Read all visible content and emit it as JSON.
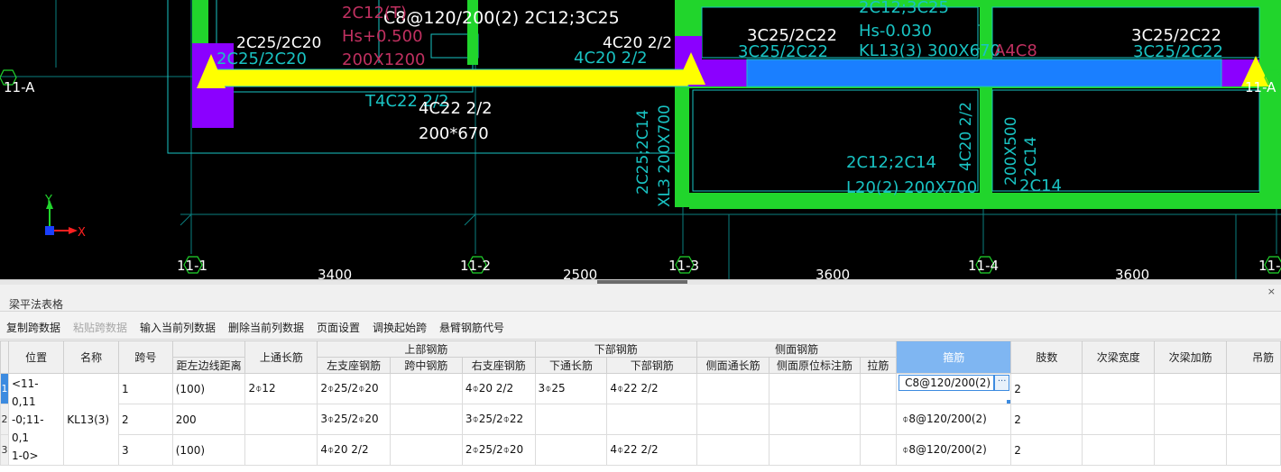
{
  "cad": {
    "labels": {
      "top_left_partial": "C8@120/200(2) 2C12;3C25",
      "cyan_2c12t": "2C12(T)",
      "cyan_hs0500": "Hs+0.500",
      "cyan_200x1200": "200X1200",
      "white_2c25_2c20": "2C25/2C20",
      "cyan_2c25_2c20": "2C25/2C20",
      "white_4c20_22": "4C20 2/2",
      "cyan_4c20_22": "4C20 2/2",
      "white_3c25_2c22_a": "3C25/2C22",
      "cyan_3c25_2c22_a": "3C25/2C22",
      "white_3c25_2c22_b": "3C25/2C22",
      "cyan_3c25_2c22_b": "3C25/2C22",
      "cyan_2c12_3c25": "2C12;3C25",
      "cyan_hs0030": "Hs-0.030",
      "cyan_kl13": "KL13(3) 300X670",
      "cyan_a4c8": "A4C8",
      "cyan_t4c22": "T4C22 2/2",
      "white_4c22": "4C22 2/2",
      "white_200x670": "200*670",
      "cyan_2c25_2c14": "2C25;2C14",
      "cyan_xl3": "XL3 200X700",
      "cyan_2c12_2c14": "2C12;2C14",
      "cyan_l20": "L20(2) 200X700",
      "cyan_4c20_22_v": "4C20 2/2",
      "cyan_200x500": "200X500",
      "cyan_2c14_a": "2C14",
      "cyan_2c14_b": "2C14",
      "axis_11a": "11-A",
      "axis_11a_right": "11-A",
      "axis_11_1": "11-1",
      "axis_11_2": "11-2",
      "axis_11_3": "11-3",
      "axis_11_4": "11-4",
      "axis_11_5": "11-",
      "dim_3400": "3400",
      "dim_2500": "2500",
      "dim_3600_a": "3600",
      "dim_3600_b": "3600",
      "ucs_y": "Y",
      "ucs_x": "X"
    },
    "colors": {
      "background": "#000000",
      "column_green": "#21d52c",
      "support_purple": "#8b00ff",
      "selected_beam_yellow": "#ffff00",
      "beam_blue": "#1a7fff",
      "cyan_text": "#19c3c3",
      "axis_line": "#008f8f"
    }
  },
  "panel": {
    "title": "梁平法表格",
    "close_label": "×",
    "toolbar": [
      {
        "label": "复制跨数据",
        "enabled": true
      },
      {
        "label": "粘贴跨数据",
        "enabled": false
      },
      {
        "label": "输入当前列数据",
        "enabled": true
      },
      {
        "label": "删除当前列数据",
        "enabled": true
      },
      {
        "label": "页面设置",
        "enabled": true
      },
      {
        "label": "调换起始跨",
        "enabled": true
      },
      {
        "label": "悬臂钢筋代号",
        "enabled": true
      }
    ]
  },
  "grid": {
    "headers": {
      "position": "位置",
      "name": "名称",
      "span_no": "跨号",
      "dist_left_edge": "距左边线距离",
      "top_through": "上通长筋",
      "top_group": "上部钢筋",
      "top_left_support": "左支座钢筋",
      "top_mid_span": "跨中钢筋",
      "top_right_support": "右支座钢筋",
      "bottom_group": "下部钢筋",
      "bottom_through": "下通长筋",
      "bottom_rebar": "下部钢筋",
      "side_group": "侧面钢筋",
      "side_through": "侧面通长筋",
      "side_in_situ": "侧面原位标注筋",
      "tie_bar": "拉筋",
      "stirrup": "箍筋",
      "legs": "肢数",
      "sec_beam_width": "次梁宽度",
      "sec_beam_rebar": "次梁加筋",
      "hanger": "吊筋"
    },
    "position_value": "<11-0,11-0;11-0,11-0>",
    "position_lines": [
      "<11-0,11",
      "-0;11-0,1",
      "1-0>"
    ],
    "name_value": "KL13(3)",
    "ellipsis": "···",
    "rows": [
      {
        "row_no": "1",
        "span_no": "1",
        "dist_left_edge": "(100)",
        "top_through": "2⌽12",
        "top_left_support": "2⌽25/2⌽20",
        "top_mid_span": "",
        "top_right_support": "4⌽20 2/2",
        "bottom_through": "3⌽25",
        "bottom_rebar": "4⌽22 2/2",
        "side_through": "",
        "side_in_situ": "",
        "tie_bar": "",
        "stirrup": "C8@120/200(2)",
        "legs": "2",
        "sec_beam_width": "",
        "sec_beam_rebar": "",
        "hanger": ""
      },
      {
        "row_no": "2",
        "span_no": "2",
        "dist_left_edge": "200",
        "top_through": "",
        "top_left_support": "3⌽25/2⌽20",
        "top_mid_span": "",
        "top_right_support": "3⌽25/2⌽22",
        "bottom_through": "",
        "bottom_rebar": "",
        "side_through": "",
        "side_in_situ": "",
        "tie_bar": "",
        "stirrup": "⌽8@120/200(2)",
        "legs": "2",
        "sec_beam_width": "",
        "sec_beam_rebar": "",
        "hanger": ""
      },
      {
        "row_no": "3",
        "span_no": "3",
        "dist_left_edge": "(100)",
        "top_through": "",
        "top_left_support": "4⌽20 2/2",
        "top_mid_span": "",
        "top_right_support": "2⌽25/2⌽20",
        "bottom_through": "",
        "bottom_rebar": "4⌽22 2/2",
        "side_through": "",
        "side_in_situ": "",
        "tie_bar": "",
        "stirrup": "⌽8@120/200(2)",
        "legs": "2",
        "sec_beam_width": "",
        "sec_beam_rebar": "",
        "hanger": ""
      }
    ]
  }
}
